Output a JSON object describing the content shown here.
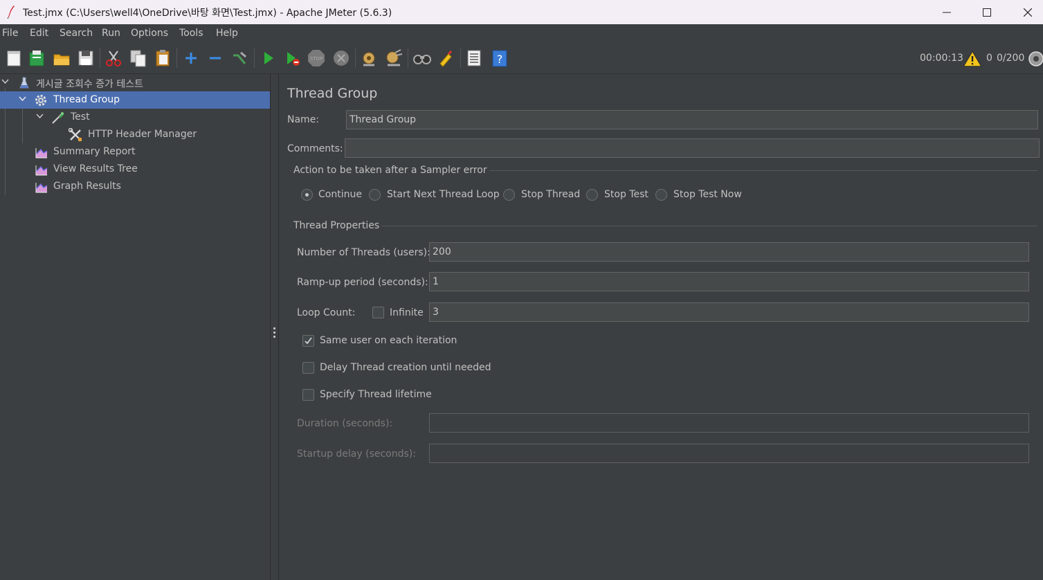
{
  "window": {
    "title": "Test.jmx (C:\\Users\\well4\\OneDrive\\바탕 화면\\Test.jmx) - Apache JMeter (5.6.3)",
    "controls": [
      "minimize-icon",
      "maximize-icon",
      "close-icon"
    ]
  },
  "menu": {
    "file": "File",
    "edit": "Edit",
    "search": "Search",
    "run": "Run",
    "options": "Options",
    "tools": "Tools",
    "help": "Help"
  },
  "toolbar": {
    "icons": [
      "new-icon",
      "templates-icon",
      "open-icon",
      "save-icon",
      "cut-icon",
      "copy-icon",
      "paste-icon",
      "expand-icon",
      "collapse-icon",
      "toggle-icon",
      "start-icon",
      "start-no-pause-icon",
      "stop-icon",
      "shutdown-icon",
      "clear-icon",
      "clear-all-icon",
      "search-icon",
      "reset-search-icon",
      "function-helper-icon",
      "help-icon"
    ],
    "elapsed_time": "00:00:13",
    "warning_count": "0",
    "active_threads": "0/200"
  },
  "tree": {
    "root": "게시글 조회수 증가 테스트",
    "items": [
      {
        "label": "Thread Group",
        "icon": "gear-icon",
        "selected": true
      },
      {
        "label": "Test",
        "icon": "sampler-icon"
      },
      {
        "label": "HTTP Header Manager",
        "icon": "config-tools-icon"
      },
      {
        "label": "Summary Report",
        "icon": "listener-chart-icon"
      },
      {
        "label": "View Results Tree",
        "icon": "listener-chart-icon"
      },
      {
        "label": "Graph Results",
        "icon": "listener-chart-icon"
      }
    ]
  },
  "panel": {
    "title": "Thread Group",
    "name_label": "Name:",
    "name_value": "Thread Group",
    "comments_label": "Comments:",
    "comments_value": "",
    "error_group_title": "Action to be taken after a Sampler error",
    "error_actions": [
      {
        "label": "Continue",
        "selected": true
      },
      {
        "label": "Start Next Thread Loop",
        "selected": false
      },
      {
        "label": "Stop Thread",
        "selected": false
      },
      {
        "label": "Stop Test",
        "selected": false
      },
      {
        "label": "Stop Test Now",
        "selected": false
      }
    ],
    "props_title": "Thread Properties",
    "threads_label": "Number of Threads (users):",
    "threads_value": "200",
    "rampup_label": "Ramp-up period (seconds):",
    "rampup_value": "1",
    "loop_label": "Loop Count:",
    "infinite_label": "Infinite",
    "infinite_checked": false,
    "loop_value": "3",
    "same_user_label": "Same user on each iteration",
    "same_user_checked": true,
    "delay_label": "Delay Thread creation until needed",
    "delay_checked": false,
    "lifetime_label": "Specify Thread lifetime",
    "lifetime_checked": false,
    "duration_label": "Duration (seconds):",
    "duration_value": "",
    "startup_label": "Startup delay (seconds):",
    "startup_value": ""
  }
}
